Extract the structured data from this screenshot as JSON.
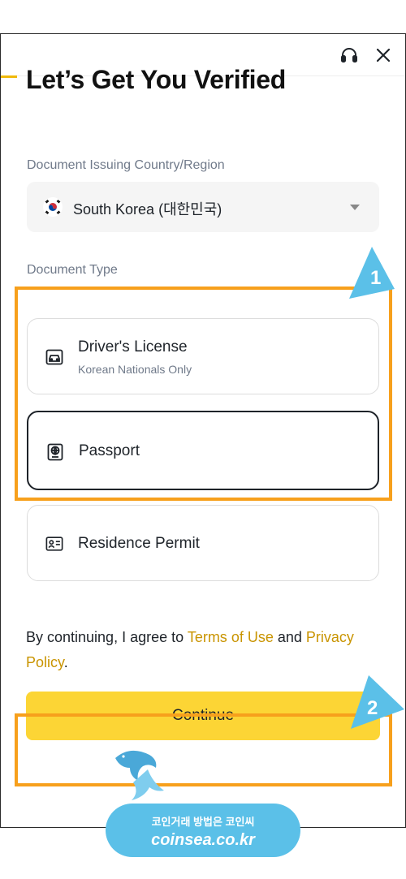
{
  "header": {
    "support_icon": "headset-icon",
    "close_icon": "close-icon",
    "progress": 0.04
  },
  "title": "Let’s Get You Verified",
  "country": {
    "label": "Document Issuing Country/Region",
    "value": "South Korea (대한민국)",
    "flag_icon": "korea-flag-icon"
  },
  "document_type": {
    "label": "Document Type",
    "options": [
      {
        "title": "Driver's License",
        "subtitle": "Korean Nationals Only",
        "icon": "car-icon",
        "selected": false
      },
      {
        "title": "Passport",
        "subtitle": "",
        "icon": "passport-icon",
        "selected": true
      },
      {
        "title": "Residence Permit",
        "subtitle": "",
        "icon": "id-card-icon",
        "selected": false
      }
    ]
  },
  "consent": {
    "prefix": "By continuing, I agree to ",
    "terms": "Terms of Use",
    "middle": " and ",
    "privacy": "Privacy Policy",
    "suffix": "."
  },
  "continue_label": "Continue",
  "annotations": {
    "marker1": "1",
    "marker2": "2",
    "highlight_color": "#f7a01c",
    "marker_color": "#5bc0e8"
  },
  "watermark": {
    "line1": "코인거래 방법은 코인씨",
    "line2": "coinsea.co.kr"
  },
  "colors": {
    "accent": "#fcd535",
    "link": "#c99400",
    "text": "#1e2329",
    "muted": "#707a8a"
  }
}
